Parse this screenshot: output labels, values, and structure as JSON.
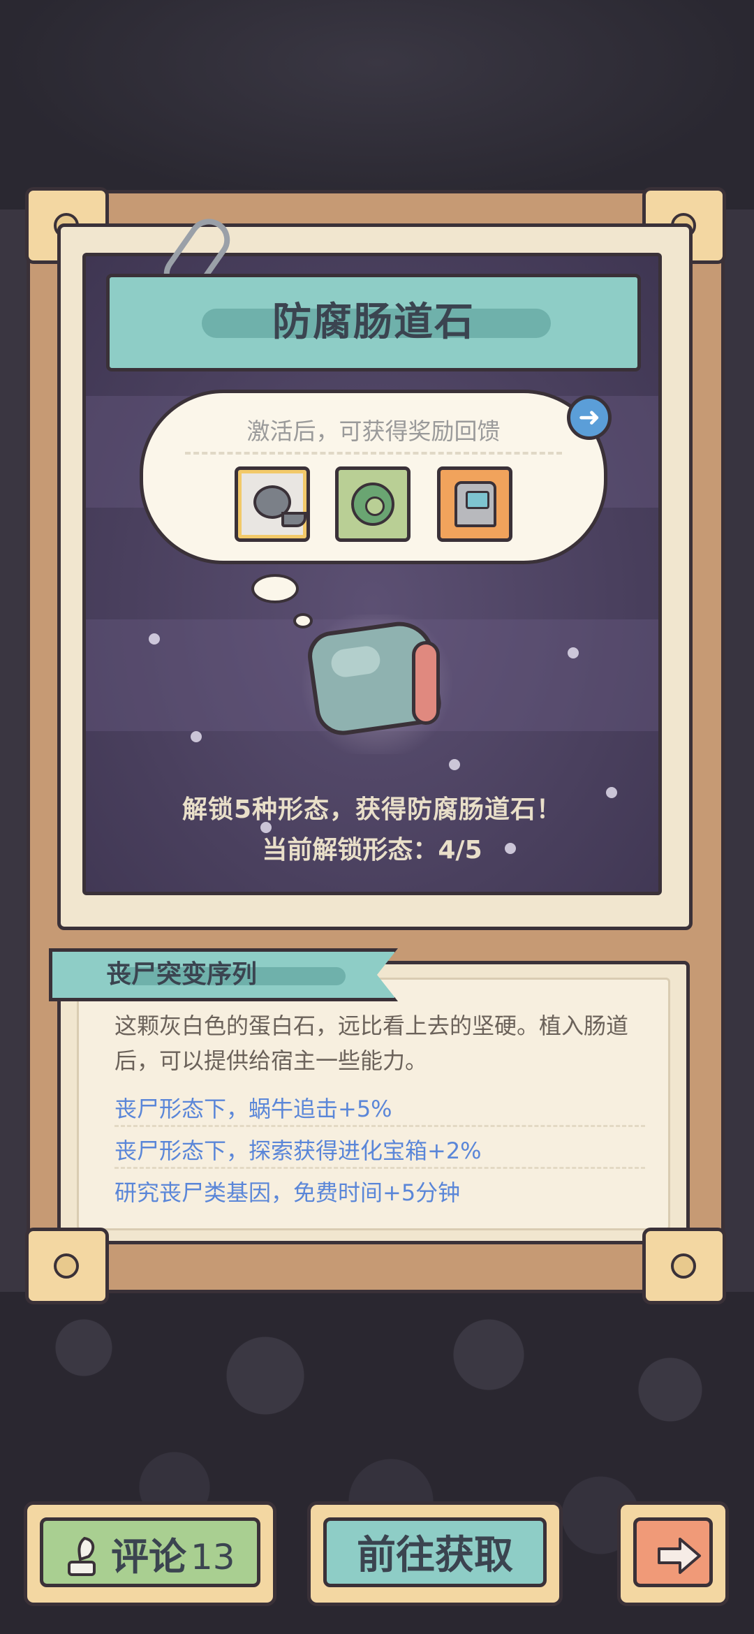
{
  "item": {
    "title": "防腐肠道石",
    "reward_hint": "激活后，可获得奖励回馈",
    "unlock_text": "解锁5种形态，获得防腐肠道石！",
    "unlock_progress_label": "当前解锁形态：",
    "unlock_progress_value": "4/5",
    "rewards": [
      {
        "name": "tadpole-reward",
        "icon": "tadpole-icon"
      },
      {
        "name": "virus-reward",
        "icon": "virus-icon"
      },
      {
        "name": "machine-reward",
        "icon": "machine-icon"
      }
    ]
  },
  "series": {
    "label": "丧尸突变序列"
  },
  "description": {
    "text": "这颗灰白色的蛋白石，远比看上去的坚硬。植入肠道后，可以提供给宿主一些能力。",
    "effects": [
      "丧尸形态下，蜗牛追击+5%",
      "丧尸形态下，探索获得进化宝箱+2%",
      "研究丧尸类基因，免费时间+5分钟"
    ]
  },
  "buttons": {
    "comment_label": "评论",
    "comment_count": "13",
    "go_label": "前往获取",
    "next_icon": "arrow-right-icon"
  },
  "colors": {
    "accent_teal": "#8ecdc6",
    "effect_blue": "#5a86d8",
    "frame_brown": "#c69a74",
    "panel_purple": "#4a405e"
  }
}
